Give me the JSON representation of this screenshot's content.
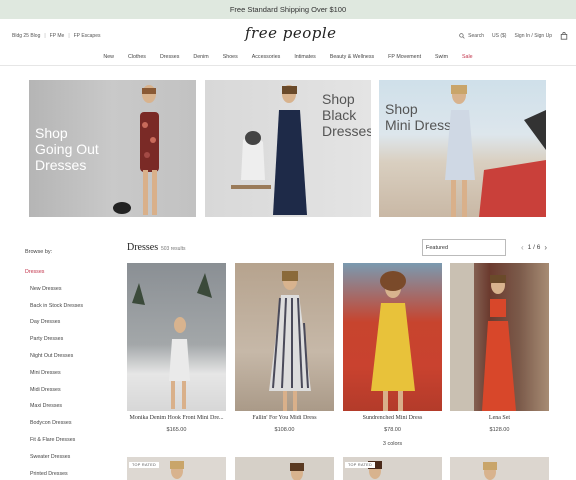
{
  "promo": {
    "text": "Free Standard Shipping Over $100"
  },
  "header": {
    "util_links": [
      "Bldg 25 Blog",
      "FP Me",
      "FP Escapes"
    ],
    "logo": "free people",
    "search_label": "Search",
    "currency": "US ($)",
    "signin": "Sign In / Sign Up"
  },
  "nav": [
    "New",
    "Clothes",
    "Dresses",
    "Denim",
    "Shoes",
    "Accessories",
    "Intimates",
    "Beauty & Wellness",
    "FP Movement",
    "Swim",
    "Sale"
  ],
  "heroes": [
    {
      "lines": [
        "Shop",
        "Going Out",
        "Dresses"
      ]
    },
    {
      "lines": [
        "Shop",
        "Black",
        "Dresses"
      ]
    },
    {
      "lines": [
        "Shop",
        "Mini Dresses"
      ]
    }
  ],
  "sidebar": {
    "label": "Browse by:",
    "items": [
      "Dresses",
      "New Dresses",
      "Back in Stock Dresses",
      "Day Dresses",
      "Party Dresses",
      "Night Out Dresses",
      "Mini Dresses",
      "Midi Dresses",
      "Maxi Dresses",
      "Bodycon Dresses",
      "Fit & Flare Dresses",
      "Sweater Dresses",
      "Printed Dresses"
    ]
  },
  "listing": {
    "title": "Dresses",
    "results": "503 results",
    "sort": "Featured",
    "page": "1 / 6"
  },
  "products": [
    {
      "name": "Monika Denim Hook Front Mini Dre...",
      "price": "$165.00",
      "colors": ""
    },
    {
      "name": "Fallin' For You Midi Dress",
      "price": "$108.00",
      "colors": ""
    },
    {
      "name": "Sundrenched Mini Dress",
      "price": "$78.00",
      "colors": "3 colors"
    },
    {
      "name": "Lena Set",
      "price": "$128.00",
      "colors": ""
    }
  ],
  "row2_badges": [
    "TOP RATED",
    "",
    "TOP RATED",
    ""
  ],
  "colors": {
    "promo_bg": "#dfe8df",
    "sale": "#c2334a",
    "active": "#c2334a"
  }
}
